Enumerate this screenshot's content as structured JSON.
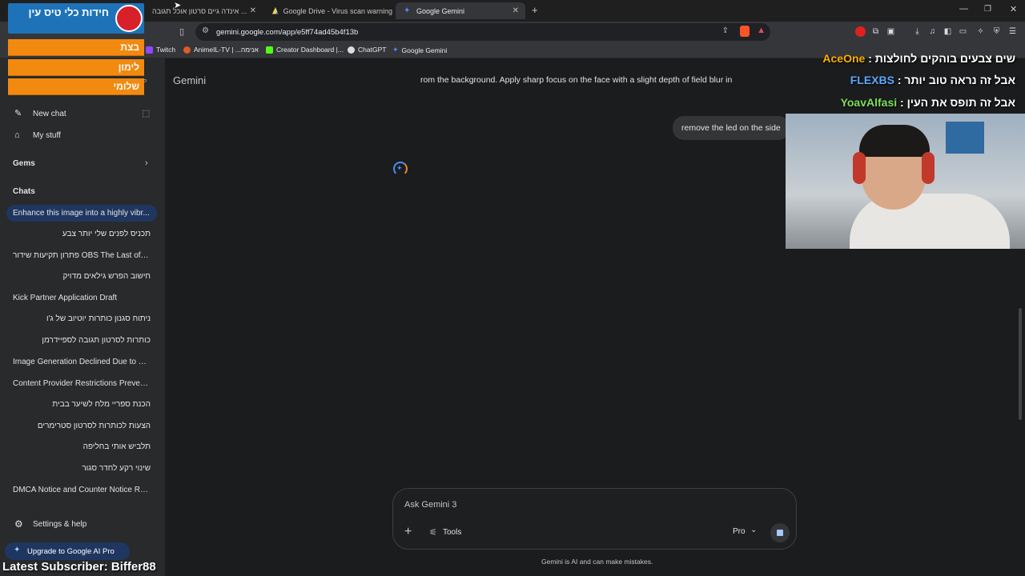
{
  "browser": {
    "tabs": [
      {
        "label": "אינדה גיים סרטון אוכל תגובה ..."
      },
      {
        "label": "Google Drive - Virus scan warning"
      },
      {
        "label": "Google Gemini"
      }
    ],
    "url": "gemini.google.com/app/e5ff74ad45b4f13b",
    "bookmarks": [
      "Twitch",
      "AnimeIL-TV | ...אנימה",
      "Creator Dashboard |...",
      "ChatGPT",
      "Google Gemini"
    ]
  },
  "sidebar": {
    "new_chat": "New chat",
    "my_stuff": "My stuff",
    "gems": "Gems",
    "chats_header": "Chats",
    "chats": [
      "Enhance this image into a highly vibr...",
      "תכניס לפנים שלי יותר צבע",
      "פתרון תקיעות שידור OBS The Last of Us",
      "חישוב הפרש גילאים מדויק",
      "Kick Partner Application Draft",
      "ניתוח סגנון כותרות יוטיוב של ג'ו",
      "כותרות לסרטון תגובה לספיידרמן",
      "Image Generation Declined Due to C...",
      "Content Provider Restrictions Preven...",
      "הכנת ספריי מלח לשיער בבית",
      "הצעות לכותרות לסרטון סטרימרים",
      "תלביש אותי בחליפה",
      "שינוי רקע לחדר סגור",
      "DMCA Notice and Counter Notice Re..."
    ],
    "settings": "Settings & help",
    "upgrade": "Upgrade to Google AI Pro"
  },
  "main": {
    "title": "Gemini",
    "prompt_line": "rom the background. Apply sharp focus on the face with a slight depth of field blur in",
    "user_message": "remove the led on the side",
    "input_placeholder": "Ask Gemini 3",
    "tools": "Tools",
    "mode": "Pro",
    "disclaimer": "Gemini is AI and can make mistakes."
  },
  "overlay": {
    "title": "חידות כלי טיס עין",
    "bars": [
      "בצת",
      "לימון",
      "שלומי"
    ],
    "chat": [
      {
        "user": "AceOne",
        "text": "שים צבעים בוהקים לחולצות :"
      },
      {
        "user": "FLEXBS",
        "text": "אבל זה נראה טוב יותר :"
      },
      {
        "user": "YoavAlfasi",
        "text": "אבל זה תופס את העין :"
      }
    ],
    "subscriber": "Latest Subscriber: Biffer88"
  },
  "colors": {
    "accent": "#1f3760",
    "orange": "#f28a10",
    "gemini_blue": "#4c8df6"
  }
}
